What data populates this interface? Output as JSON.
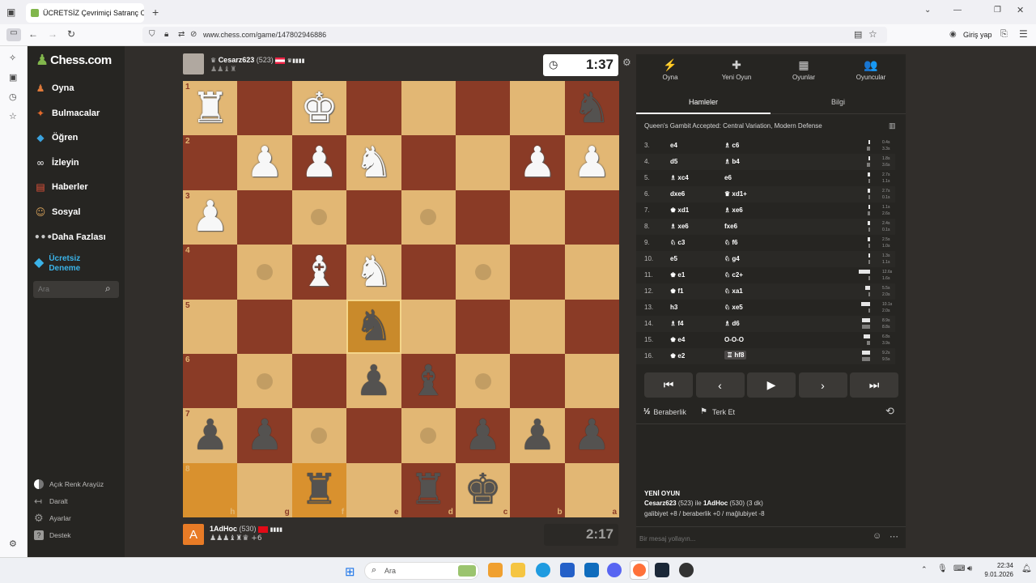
{
  "browser": {
    "tab_title": "ÜCRETSİZ Çevrimiçi Satranç Oy",
    "tab_close": "✕",
    "new_tab": "+",
    "url": "www.chess.com/game/147802946886",
    "signin_label": "Giriş yap"
  },
  "sidebar": {
    "logo": "Chess.com",
    "items": [
      {
        "label": "Oyna",
        "icon": "pawn-icon",
        "color": "#e07a3a"
      },
      {
        "label": "Bulmacalar",
        "icon": "puzzle-icon",
        "color": "#e46a2b"
      },
      {
        "label": "Öğren",
        "icon": "learn-icon",
        "color": "#3ba3df"
      },
      {
        "label": "İzleyin",
        "icon": "binoculars-icon",
        "color": "#c8c8c8"
      },
      {
        "label": "Haberler",
        "icon": "news-icon",
        "color": "#e8533b"
      },
      {
        "label": "Sosyal",
        "icon": "social-icon",
        "color": "#d9a35b"
      },
      {
        "label": "Daha Fazlası",
        "icon": "more-icon",
        "color": "#c8c8c8"
      }
    ],
    "free_trial_line1": "Ücretsiz",
    "free_trial_line2": "Deneme",
    "search_placeholder": "Ara",
    "bottom": [
      "Açık Renk Arayüz",
      "Daralt",
      "Ayarlar",
      "Destek"
    ]
  },
  "top_player": {
    "name": "Cesarz623",
    "rating": "(523)",
    "clock": "1:37"
  },
  "bottom_player": {
    "avatar_letter": "A",
    "name": "1AdHoc",
    "rating": "(530)",
    "material": "+6",
    "clock": "2:17"
  },
  "board": {
    "ranks": [
      "1",
      "2",
      "3",
      "4",
      "5",
      "6",
      "7",
      "8"
    ],
    "files": [
      "h",
      "g",
      "f",
      "e",
      "d",
      "c",
      "b",
      "a"
    ],
    "pieces": {
      "0,0": {
        "color": "w",
        "glyph": "♜"
      },
      "0,2": {
        "color": "w",
        "glyph": "♚"
      },
      "0,7": {
        "color": "b",
        "glyph": "♞"
      },
      "1,1": {
        "color": "w",
        "glyph": "♟"
      },
      "1,2": {
        "color": "w",
        "glyph": "♟"
      },
      "1,3": {
        "color": "w",
        "glyph": "♞"
      },
      "1,6": {
        "color": "w",
        "glyph": "♟"
      },
      "1,7": {
        "color": "w",
        "glyph": "♟"
      },
      "2,0": {
        "color": "w",
        "glyph": "♟"
      },
      "3,2": {
        "color": "w",
        "glyph": "♝"
      },
      "3,3": {
        "color": "w",
        "glyph": "♞"
      },
      "4,3": {
        "color": "b",
        "glyph": "♞"
      },
      "5,3": {
        "color": "b",
        "glyph": "♟"
      },
      "5,4": {
        "color": "b",
        "glyph": "♝"
      },
      "6,0": {
        "color": "b",
        "glyph": "♟"
      },
      "6,1": {
        "color": "b",
        "glyph": "♟"
      },
      "6,5": {
        "color": "b",
        "glyph": "♟"
      },
      "6,6": {
        "color": "b",
        "glyph": "♟"
      },
      "6,7": {
        "color": "b",
        "glyph": "♟"
      },
      "7,2": {
        "color": "b",
        "glyph": "♜"
      },
      "7,4": {
        "color": "b",
        "glyph": "♜"
      },
      "7,5": {
        "color": "b",
        "glyph": "♚"
      }
    },
    "dots": [
      "2,2",
      "2,4",
      "3,1",
      "3,5",
      "5,1",
      "5,5",
      "6,2",
      "6,4"
    ],
    "highlight": [
      "7,0",
      "7,2"
    ],
    "selected": [
      "4,3"
    ]
  },
  "panel": {
    "tabs": [
      {
        "label": "Oyna",
        "icon": "⚡"
      },
      {
        "label": "Yeni Oyun",
        "icon": "✚"
      },
      {
        "label": "Oyunlar",
        "icon": "▦"
      },
      {
        "label": "Oyuncular",
        "icon": "👥"
      }
    ],
    "subtabs": [
      "Hamleler",
      "Bilgi"
    ],
    "opening": "Queen's Gambit Accepted: Central Variation, Modern Defense",
    "moves": [
      {
        "n": "3.",
        "w": "e4",
        "b": "♗ c6",
        "tw": "0.4s",
        "tb": "3.3s",
        "fw": 0.03,
        "fb": 0.26
      },
      {
        "n": "4.",
        "w": "d5",
        "b": "♗ b4",
        "tw": "1.8s",
        "tb": "3.6s",
        "fw": 0.14,
        "fb": 0.29
      },
      {
        "n": "5.",
        "w": "♗ xc4",
        "b": "e6",
        "tw": "2.7s",
        "tb": "1.1s",
        "fw": 0.21,
        "fb": 0.09
      },
      {
        "n": "6.",
        "w": "dxe6",
        "b": "♛ xd1+",
        "tw": "2.7s",
        "tb": "0.1s",
        "fw": 0.21,
        "fb": 0.01
      },
      {
        "n": "7.",
        "w": "♚ xd1",
        "b": "♗ xe6",
        "tw": "1.1s",
        "tb": "2.6s",
        "fw": 0.09,
        "fb": 0.21
      },
      {
        "n": "8.",
        "w": "♗ xe6",
        "b": "fxe6",
        "tw": "2.4s",
        "tb": "0.1s",
        "fw": 0.19,
        "fb": 0.01
      },
      {
        "n": "9.",
        "w": "♘ c3",
        "b": "♘ f6",
        "tw": "2.5s",
        "tb": "1.0s",
        "fw": 0.2,
        "fb": 0.08
      },
      {
        "n": "10.",
        "w": "e5",
        "b": "♘ g4",
        "tw": "1.3s",
        "tb": "1.1s",
        "fw": 0.1,
        "fb": 0.09
      },
      {
        "n": "11.",
        "w": "♚ e1",
        "b": "♘ c2+",
        "tw": "12.6s",
        "tb": "1.6s",
        "fw": 1.0,
        "fb": 0.13
      },
      {
        "n": "12.",
        "w": "♚ f1",
        "b": "♘ xa1",
        "tw": "5.5s",
        "tb": "2.0s",
        "fw": 0.44,
        "fb": 0.16
      },
      {
        "n": "13.",
        "w": "h3",
        "b": "♘ xe5",
        "tw": "10.1s",
        "tb": "2.0s",
        "fw": 0.8,
        "fb": 0.16
      },
      {
        "n": "14.",
        "w": "♗ f4",
        "b": "♗ d6",
        "tw": "8.9s",
        "tb": "8.8s",
        "fw": 0.71,
        "fb": 0.7
      },
      {
        "n": "15.",
        "w": "♚ e4",
        "b": "O-O-O",
        "tw": "6.8s",
        "tb": "3.9s",
        "fw": 0.54,
        "fb": 0.31
      },
      {
        "n": "16.",
        "w": "♚ e2",
        "b": "♖ hf8",
        "tw": "9.2s",
        "tb": "9.5s",
        "fw": 0.73,
        "fb": 0.75
      }
    ],
    "controls": [
      "⏮",
      "‹",
      "▶",
      "›",
      "⏭"
    ],
    "draw_label": "Beraberlik",
    "draw_icon": "½",
    "resign_label": "Terk Et",
    "new_game_title": "YENİ OYUN",
    "new_game_line1_a": "Cesarz623",
    "new_game_line1_b": " (523) ile ",
    "new_game_line1_c": "1AdHoc",
    "new_game_line1_d": " (530) (3 dk)",
    "new_game_line2": "galibiyet +8 / beraberlik +0 / mağlubiyet -8",
    "chat_placeholder": "Bir mesaj yollayın..."
  },
  "taskbar": {
    "search_label": "Ara",
    "time": "22:34",
    "date": "9.01.2026"
  }
}
